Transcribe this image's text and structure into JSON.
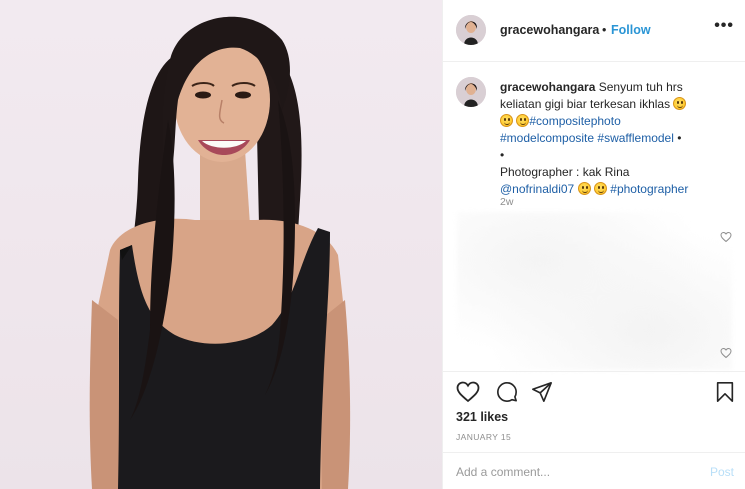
{
  "header": {
    "username": "gracewohangara",
    "separator": "•",
    "follow_label": "Follow",
    "more_label": "•••"
  },
  "caption": {
    "username": "gracewohangara",
    "text_line1": "Senyum tuh hrs",
    "text_line2": "keliatan gigi biar terkesan ikhlas",
    "tag_compositephoto": "#compositephoto",
    "tag_modelcomposite": "#modelcomposite",
    "tag_swafflemodel": "#swafflemodel",
    "bullet1": "•",
    "bullet2": "•",
    "photographer": "Photographer : kak Rina",
    "mention": "@nofrinaldi07",
    "tag_photographer": "#photographer",
    "time_ago": "2w"
  },
  "actions": {
    "like_icon": "heart-outline-icon",
    "comment_icon": "speech-bubble-icon",
    "share_icon": "paper-plane-icon",
    "save_icon": "bookmark-icon",
    "likes_text": "321 likes",
    "date_text": "JANUARY 15"
  },
  "comment_box": {
    "placeholder": "Add a comment...",
    "post_label": "Post"
  },
  "colors": {
    "link": "#2a95d5",
    "hashtag": "#1e5fa6",
    "muted": "#8e8e8e",
    "post_disabled": "#b9dff8",
    "photo_background": "#f0e8ee"
  }
}
